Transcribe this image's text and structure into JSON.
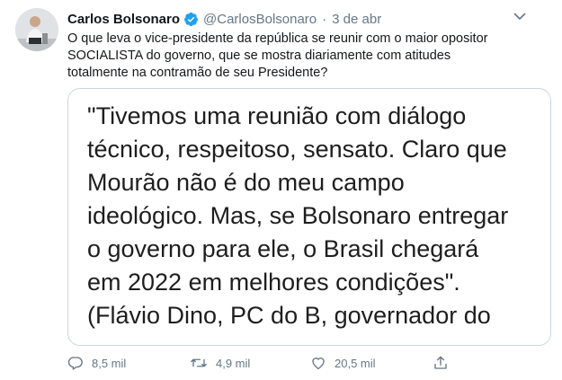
{
  "tweet": {
    "author_name": "Carlos Bolsonaro",
    "author_handle": "@CarlosBolsonaro",
    "separator": "·",
    "date": "3 de abr",
    "text_lines": [
      "O que leva o vice-presidente da república se reunir com o maior opositor",
      "SOCIALISTA do governo, que se mostra diariamente com atitudes",
      "totalmente na contramão de seu Presidente?"
    ],
    "media_quote_lines": [
      "\"Tivemos uma reunião com diálogo",
      "técnico, respeitoso, sensato. Claro que",
      "Mourão não é do meu campo",
      "ideológico. Mas, se Bolsonaro entregar",
      "o governo para ele, o Brasil chegará",
      "em 2022 em melhores condições\".",
      "(Flávio Dino, PC do B, governador do"
    ],
    "icons": {
      "verified": "verified-badge-icon",
      "more": "chevron-down-icon",
      "reply": "reply-icon",
      "retweet": "retweet-icon",
      "like": "heart-icon",
      "share": "share-icon"
    },
    "actions": {
      "reply_count": "8,5 mil",
      "retweet_count": "4,9 mil",
      "like_count": "20,5 mil"
    }
  },
  "colors": {
    "verified_blue": "#1da1f2",
    "secondary_text": "#657786",
    "border": "#ccd6dd"
  }
}
